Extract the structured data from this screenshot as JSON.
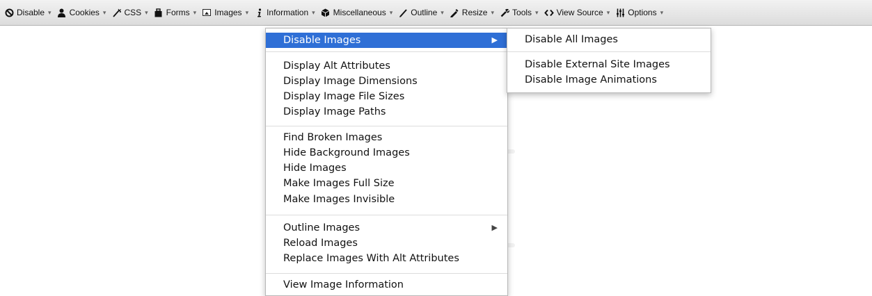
{
  "toolbar": {
    "items": [
      {
        "label": "Disable",
        "icon": "disable-icon"
      },
      {
        "label": "Cookies",
        "icon": "cookies-icon"
      },
      {
        "label": "CSS",
        "icon": "css-icon"
      },
      {
        "label": "Forms",
        "icon": "forms-icon"
      },
      {
        "label": "Images",
        "icon": "images-icon"
      },
      {
        "label": "Information",
        "icon": "information-icon"
      },
      {
        "label": "Miscellaneous",
        "icon": "miscellaneous-icon"
      },
      {
        "label": "Outline",
        "icon": "outline-icon"
      },
      {
        "label": "Resize",
        "icon": "resize-icon"
      },
      {
        "label": "Tools",
        "icon": "tools-icon"
      },
      {
        "label": "View Source",
        "icon": "view-source-icon"
      },
      {
        "label": "Options",
        "icon": "options-icon"
      }
    ],
    "caret": "▾"
  },
  "images_menu": {
    "disable_images": "Disable Images",
    "display_alt_attributes": "Display Alt Attributes",
    "display_image_dimensions": "Display Image Dimensions",
    "display_image_file_sizes": "Display Image File Sizes",
    "display_image_paths": "Display Image Paths",
    "find_broken_images": "Find Broken Images",
    "hide_background_images": "Hide Background Images",
    "hide_images": "Hide Images",
    "make_images_full_size": "Make Images Full Size",
    "make_images_invisible": "Make Images Invisible",
    "outline_images": "Outline Images",
    "reload_images": "Reload Images",
    "replace_images_with_alt": "Replace Images With Alt Attributes",
    "view_image_information": "View Image Information",
    "submenu_arrow": "▶"
  },
  "disable_images_submenu": {
    "disable_all_images": "Disable All Images",
    "disable_external_site_images": "Disable External Site Images",
    "disable_image_animations": "Disable Image Animations"
  },
  "colors": {
    "highlight": "#2f6fd6",
    "toolbar_top": "#f2f2f2",
    "toolbar_bottom": "#dcdcdc"
  }
}
